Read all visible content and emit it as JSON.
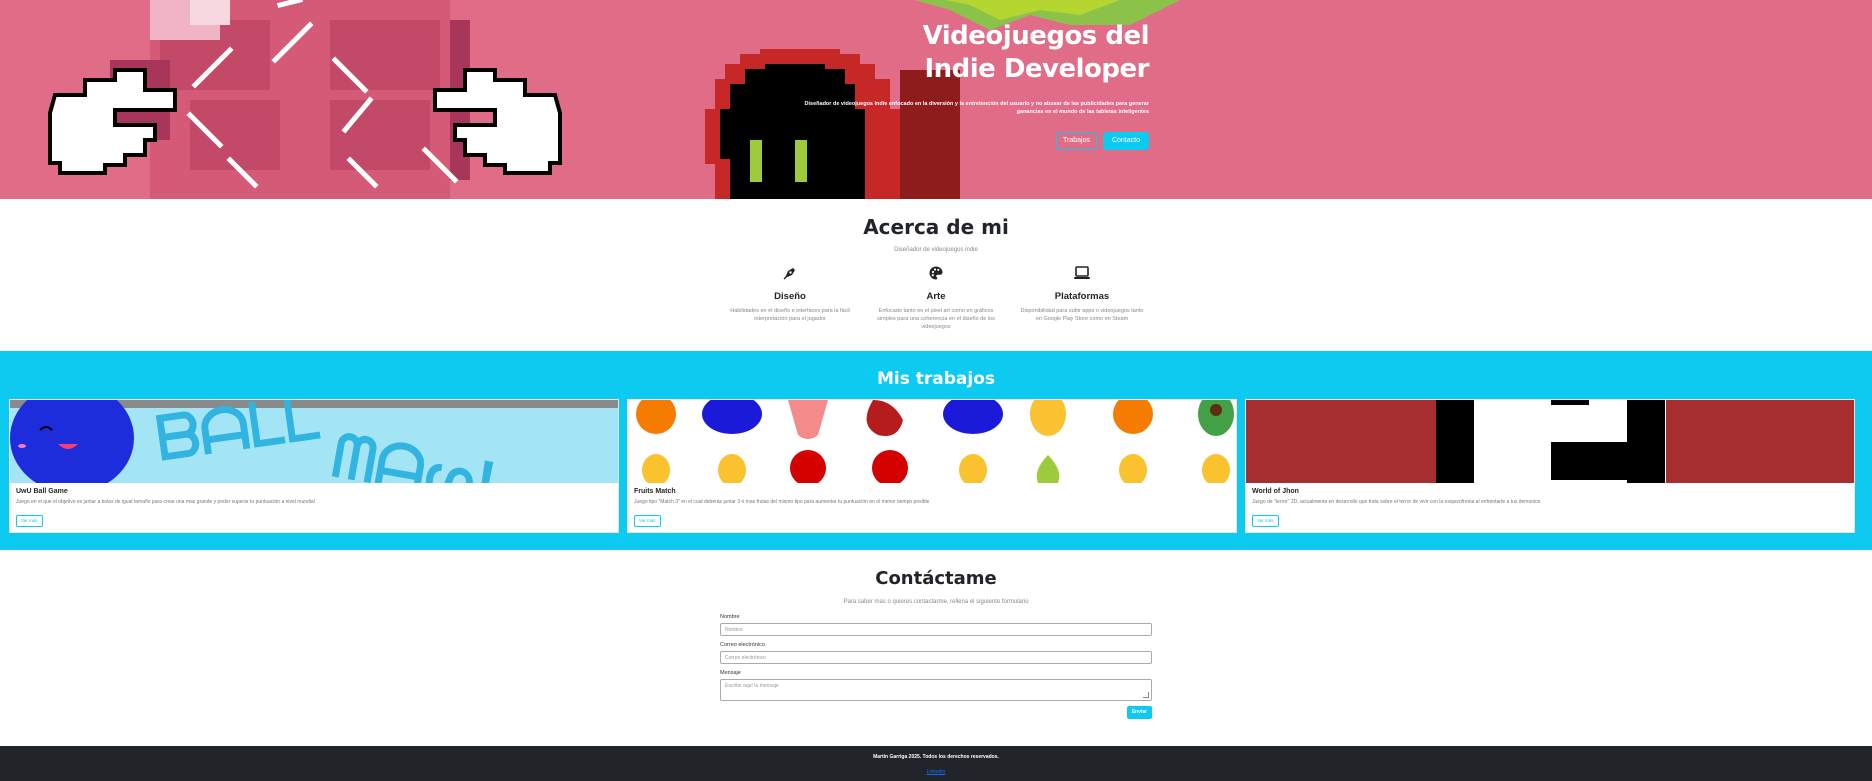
{
  "hero": {
    "title_line1": "Videojuegos del",
    "title_line2": "Indie Developer",
    "description": "Diseñador de videojuegos indie enfocado en la diversión y la entretención del usuario y no abusar de las publicidades para generar ganancias en el mundo de las tabletas inteligentes",
    "btn_works": "Trabajos",
    "btn_contact": "Contacto"
  },
  "about": {
    "title": "Acerca de mi",
    "subtitle": "Diseñador de videojuegos indie",
    "skills": [
      {
        "icon": "pen-nib-icon",
        "name": "Diseño",
        "desc": "Habilidades en el diseño e interfaces para la fácil interpretación para el jugador"
      },
      {
        "icon": "palette-icon",
        "name": "Arte",
        "desc": "Enfocado tanto en el pixel art como en gráficos simples para una coherencia en el diseño de los videojuegos"
      },
      {
        "icon": "laptop-icon",
        "name": "Plataformas",
        "desc": "Disponibilidad para subir apps o videojuegos tanto en Google Play Store como en Steam"
      }
    ]
  },
  "works": {
    "title": "Mis trabajos",
    "cards": [
      {
        "title": "UwU Ball Game",
        "desc": "Juego en el que el objetivo es juntar a bolas de igual tamaño para crear una mas grande y poder superar tu puntuación a nivel mundial",
        "btn": "Ver más"
      },
      {
        "title": "Fruits Match",
        "desc": "Juego tipo \"Match 3\" en el cual deberás juntar 3 o mas frutas del mismo tipo para aumentar tu puntuación en el menor tiempo posible",
        "btn": "Ver más"
      },
      {
        "title": "World of Jhon",
        "desc": "Juego de \"terror\" 2D, actualmente en desarrollo que trata sobre el terror de vivir con la esquizofrenia al enfrentarte a tus demonios",
        "btn": "Ver más"
      }
    ]
  },
  "contact": {
    "title": "Contáctame",
    "subtitle": "Para saber mas o quieres contactarme, rellena el siguiente formulario",
    "name_label": "Nombre",
    "name_placeholder": "Nombre",
    "email_label": "Correo electrónico",
    "email_placeholder": "Correo electrónico",
    "message_label": "Mensaje",
    "message_placeholder": "Escribe aquí tu mensaje",
    "send": "Enviar"
  },
  "footer": {
    "copyright": "Martin Garriga 2025. Todos los derechos reservados.",
    "link": "Linkedin"
  },
  "colors": {
    "hero_bg": "#e06c88",
    "accent": "#0dcaf0",
    "footer_bg": "#212529"
  }
}
